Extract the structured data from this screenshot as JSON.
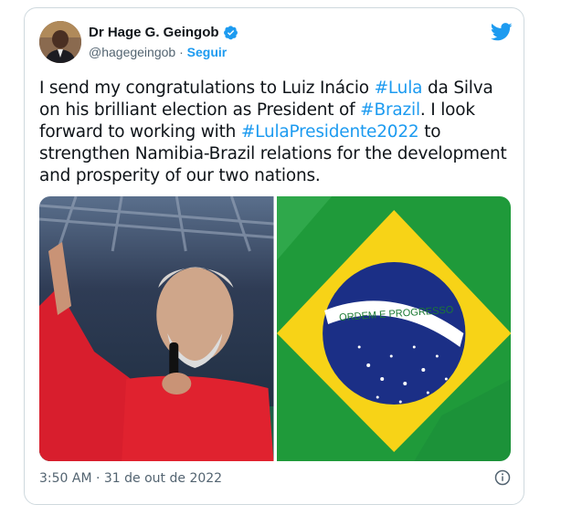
{
  "tweet": {
    "author_name": "Dr Hage G. Geingob",
    "handle": "@hagegeingob",
    "separator": " · ",
    "follow_label": "Seguir",
    "text_parts": [
      {
        "t": "I send my congratulations to Luiz Inácio "
      },
      {
        "t": "#Lula",
        "tag": true
      },
      {
        "t": " da Silva on his brilliant election as President of "
      },
      {
        "t": "#Brazil",
        "tag": true
      },
      {
        "t": ". I look forward to working with  "
      },
      {
        "t": "#LulaPresidente2022",
        "tag": true
      },
      {
        "t": " to strengthen Namibia-Brazil relations for the development and prosperity of our two nations."
      }
    ],
    "timestamp": "3:50 AM · 31 de out de 2022",
    "flag_motto": "ORDEM E PROGRESSO",
    "icons": [
      "verified-icon",
      "twitter-logo-icon",
      "info-icon"
    ],
    "colors": {
      "accent": "#1d9bf0",
      "text": "#0f1419",
      "muted": "#536471"
    }
  }
}
